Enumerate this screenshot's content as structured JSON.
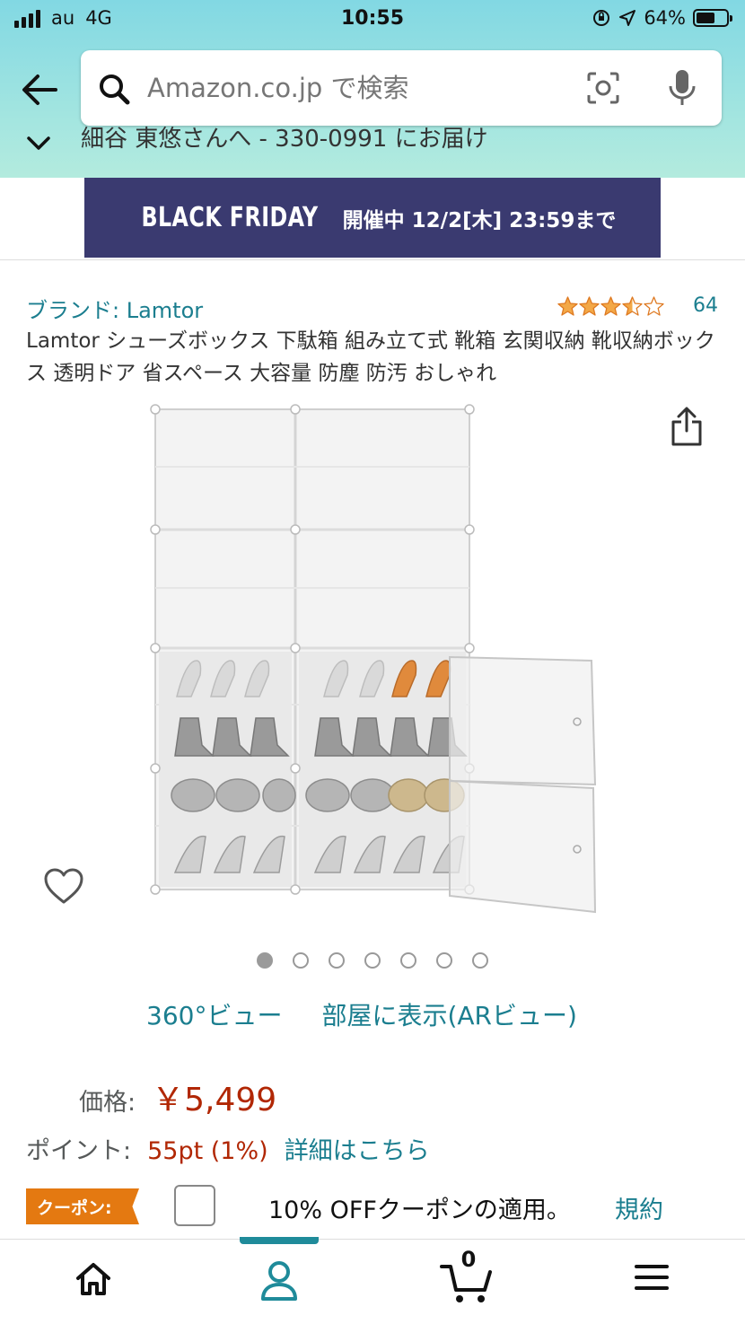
{
  "status_bar": {
    "carrier": "au",
    "network": "4G",
    "time": "10:55",
    "battery": "64%",
    "battery_level": 0.64
  },
  "search": {
    "placeholder": "Amazon.co.jp で検索"
  },
  "delivery": {
    "text": "細谷 東悠さんへ - 330-0991 にお届け"
  },
  "banner": {
    "title": "BLACK FRIDAY",
    "subtitle": "開催中 12/2[木] 23:59まで"
  },
  "product": {
    "brand": "ブランド: Lamtor",
    "rating": 3.5,
    "rating_count": "64",
    "title": "Lamtor シューズボックス 下駄箱 組み立て式 靴箱 玄関収納 靴収納ボックス 透明ドア 省スペース 大容量 防塵 防汚 おしゃれ",
    "image_count": 7,
    "active_image": 0
  },
  "view_links": {
    "view360": "360°ビュー",
    "ar_view": "部屋に表示(ARビュー)"
  },
  "price": {
    "label": "価格:",
    "value": "￥5,499"
  },
  "points": {
    "label": "ポイント:",
    "value": "55pt (1%)",
    "link": "詳細はこちら"
  },
  "coupon": {
    "badge": "クーポン:",
    "text": "10% OFFクーポンの適用。",
    "link": "規約"
  },
  "tabbar": {
    "cart_count": "0"
  },
  "colors": {
    "link": "#1b7e8f",
    "price": "#b12704",
    "coupon": "#e47911",
    "banner": "#3a3a70",
    "star": "#f3a847"
  }
}
